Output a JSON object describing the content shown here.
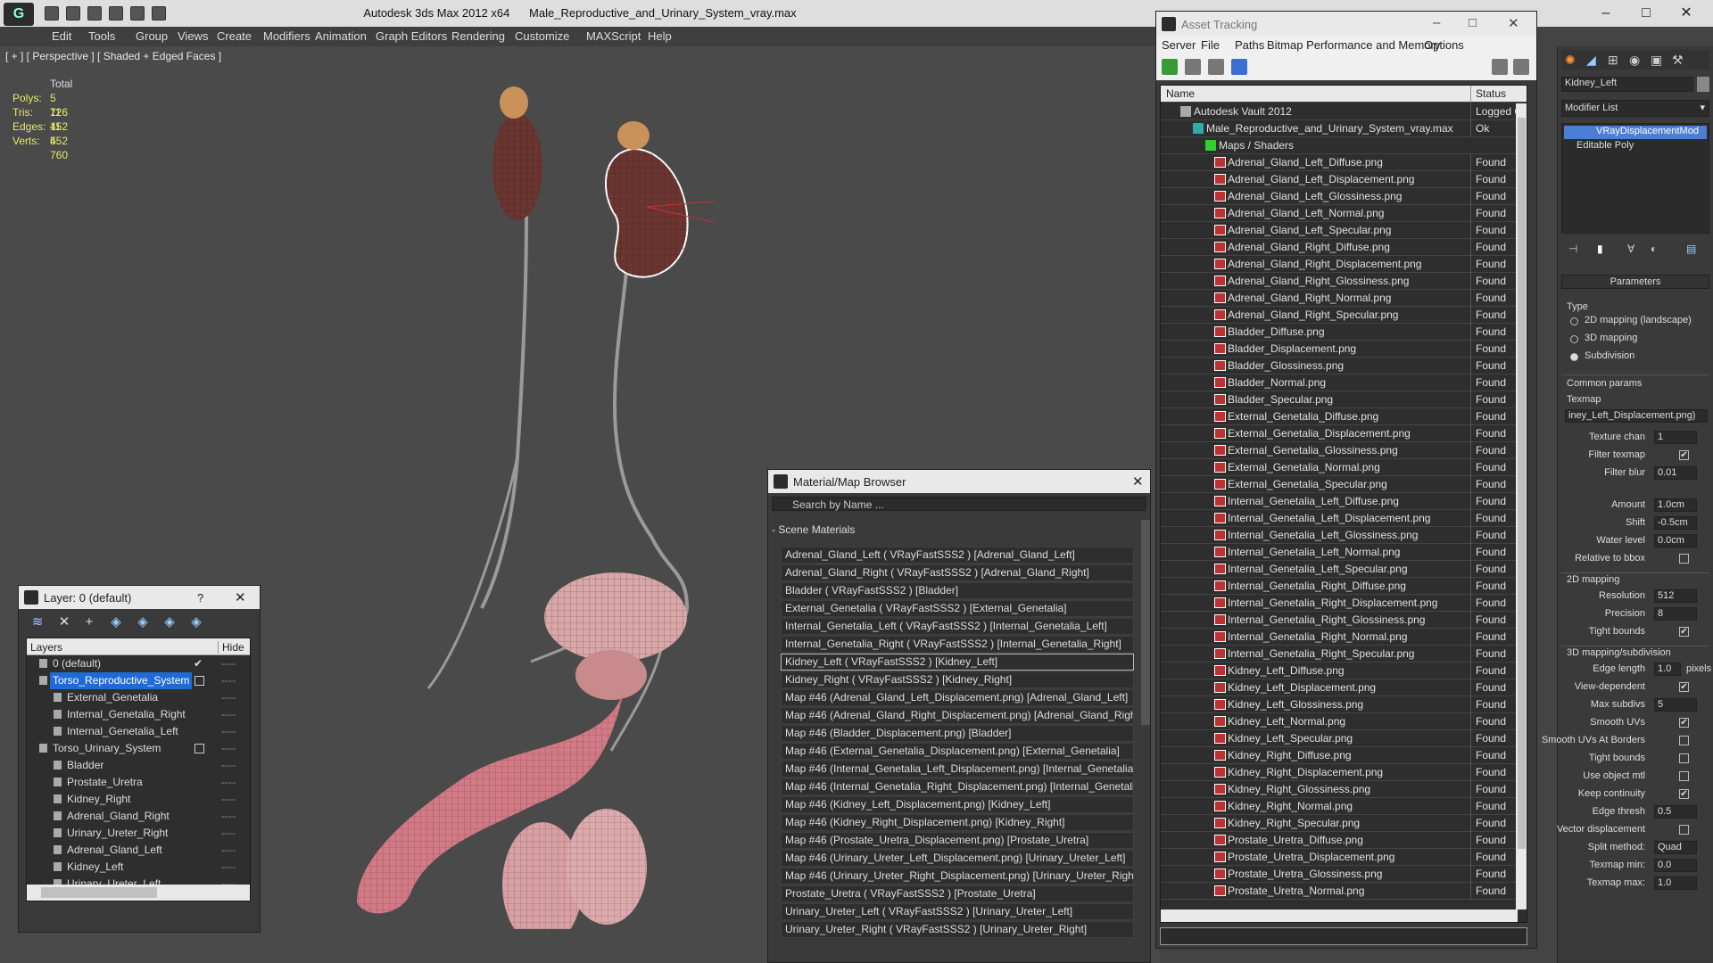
{
  "app": {
    "title": "Autodesk 3ds Max  2012 x64",
    "file": "Male_Reproductive_and_Urinary_System_vray.max"
  },
  "menu": [
    "Edit",
    "Tools",
    "Group",
    "Views",
    "Create",
    "Modifiers",
    "Animation",
    "Graph Editors",
    "Rendering",
    "Customize",
    "MAXScript",
    "Help"
  ],
  "viewport": {
    "label": "[ + ] [ Perspective ] [ Shaded + Edged Faces ]",
    "stats": {
      "header": "Total",
      "rows": [
        {
          "label": "Polys:",
          "value": "5 726"
        },
        {
          "label": "Tris:",
          "value": "11 452"
        },
        {
          "label": "Edges:",
          "value": "11 452"
        },
        {
          "label": "Verts:",
          "value": "5 760"
        }
      ]
    }
  },
  "layer_dialog": {
    "title": "Layer: 0 (default)",
    "help": "?",
    "col_layers": "Layers",
    "col_hide": "Hide",
    "rows": [
      {
        "name": "0 (default)",
        "level": 1
      },
      {
        "name": "Torso_Reproductive_System",
        "level": 1
      },
      {
        "name": "External_Genetalia",
        "level": 2
      },
      {
        "name": "Internal_Genetalia_Right",
        "level": 2
      },
      {
        "name": "Internal_Genetalia_Left",
        "level": 2
      },
      {
        "name": "Torso_Urinary_System",
        "level": 1
      },
      {
        "name": "Bladder",
        "level": 2
      },
      {
        "name": "Prostate_Uretra",
        "level": 2
      },
      {
        "name": "Kidney_Right",
        "level": 2
      },
      {
        "name": "Adrenal_Gland_Right",
        "level": 2
      },
      {
        "name": "Urinary_Ureter_Right",
        "level": 2
      },
      {
        "name": "Adrenal_Gland_Left",
        "level": 2
      },
      {
        "name": "Kidney_Left",
        "level": 2
      },
      {
        "name": "Urinary_Ureter_Left",
        "level": 2
      }
    ],
    "hide_mark": "----"
  },
  "material_browser": {
    "title": "Material/Map Browser",
    "search_placeholder": "Search by Name ...",
    "section": "- Scene Materials",
    "items": [
      "Adrenal_Gland_Left  ( VRayFastSSS2 )  [Adrenal_Gland_Left]",
      "Adrenal_Gland_Right  ( VRayFastSSS2 )  [Adrenal_Gland_Right]",
      "Bladder  ( VRayFastSSS2 )  [Bladder]",
      "External_Genetalia  ( VRayFastSSS2 )  [External_Genetalia]",
      "Internal_Genetalia_Left  ( VRayFastSSS2 )  [Internal_Genetalia_Left]",
      "Internal_Genetalia_Right  ( VRayFastSSS2 )  [Internal_Genetalia_Right]",
      "Kidney_Left  ( VRayFastSSS2 )  [Kidney_Left]",
      "Kidney_Right  ( VRayFastSSS2 )  [Kidney_Right]",
      "Map #46 (Adrenal_Gland_Left_Displacement.png) [Adrenal_Gland_Left]",
      "Map #46 (Adrenal_Gland_Right_Displacement.png) [Adrenal_Gland_Right]",
      "Map #46 (Bladder_Displacement.png) [Bladder]",
      "Map #46 (External_Genetalia_Displacement.png) [External_Genetalia]",
      "Map #46 (Internal_Genetalia_Left_Displacement.png) [Internal_Genetalia...",
      "Map #46 (Internal_Genetalia_Right_Displacement.png) [Internal_Genetali...",
      "Map #46 (Kidney_Left_Displacement.png) [Kidney_Left]",
      "Map #46 (Kidney_Right_Displacement.png) [Kidney_Right]",
      "Map #46 (Prostate_Uretra_Displacement.png) [Prostate_Uretra]",
      "Map #46 (Urinary_Ureter_Left_Displacement.png) [Urinary_Ureter_Left]",
      "Map #46 (Urinary_Ureter_Right_Displacement.png) [Urinary_Ureter_Right]",
      "Prostate_Uretra  ( VRayFastSSS2 )  [Prostate_Uretra]",
      "Urinary_Ureter_Left  ( VRayFastSSS2 )  [Urinary_Ureter_Left]",
      "Urinary_Ureter_Right  ( VRayFastSSS2 )  [Urinary_Ureter_Right]"
    ]
  },
  "asset_tracking": {
    "title": "Asset Tracking",
    "menu": [
      "Server",
      "File",
      "Paths",
      "Bitmap Performance and Memory",
      "Options"
    ],
    "col_name": "Name",
    "col_status": "Status",
    "vault": {
      "name": "Autodesk Vault 2012",
      "status": "Logged O"
    },
    "file": {
      "name": "Male_Reproductive_and_Urinary_System_vray.max",
      "status": "Ok"
    },
    "maps_folder": "Maps / Shaders",
    "maps": [
      "Adrenal_Gland_Left_Diffuse.png",
      "Adrenal_Gland_Left_Displacement.png",
      "Adrenal_Gland_Left_Glossiness.png",
      "Adrenal_Gland_Left_Normal.png",
      "Adrenal_Gland_Left_Specular.png",
      "Adrenal_Gland_Right_Diffuse.png",
      "Adrenal_Gland_Right_Displacement.png",
      "Adrenal_Gland_Right_Glossiness.png",
      "Adrenal_Gland_Right_Normal.png",
      "Adrenal_Gland_Right_Specular.png",
      "Bladder_Diffuse.png",
      "Bladder_Displacement.png",
      "Bladder_Glossiness.png",
      "Bladder_Normal.png",
      "Bladder_Specular.png",
      "External_Genetalia_Diffuse.png",
      "External_Genetalia_Displacement.png",
      "External_Genetalia_Glossiness.png",
      "External_Genetalia_Normal.png",
      "External_Genetalia_Specular.png",
      "Internal_Genetalia_Left_Diffuse.png",
      "Internal_Genetalia_Left_Displacement.png",
      "Internal_Genetalia_Left_Glossiness.png",
      "Internal_Genetalia_Left_Normal.png",
      "Internal_Genetalia_Left_Specular.png",
      "Internal_Genetalia_Right_Diffuse.png",
      "Internal_Genetalia_Right_Displacement.png",
      "Internal_Genetalia_Right_Glossiness.png",
      "Internal_Genetalia_Right_Normal.png",
      "Internal_Genetalia_Right_Specular.png",
      "Kidney_Left_Diffuse.png",
      "Kidney_Left_Displacement.png",
      "Kidney_Left_Glossiness.png",
      "Kidney_Left_Normal.png",
      "Kidney_Left_Specular.png",
      "Kidney_Right_Diffuse.png",
      "Kidney_Right_Displacement.png",
      "Kidney_Right_Glossiness.png",
      "Kidney_Right_Normal.png",
      "Kidney_Right_Specular.png",
      "Prostate_Uretra_Diffuse.png",
      "Prostate_Uretra_Displacement.png",
      "Prostate_Uretra_Glossiness.png",
      "Prostate_Uretra_Normal.png"
    ],
    "found": "Found"
  },
  "command_panel": {
    "object_name": "Kidney_Left",
    "modifier_list": "Modifier List",
    "stack": [
      "VRayDisplacementMod",
      "Editable Poly"
    ],
    "rollout": "Parameters",
    "type_label": "Type",
    "type_options": [
      "2D mapping (landscape)",
      "3D mapping",
      "Subdivision"
    ],
    "common_params": "Common params",
    "texmap_label": "Texmap",
    "texmap_value": "iney_Left_Displacement.png)",
    "fields": [
      {
        "label": "Texture chan",
        "value": "1"
      },
      {
        "label": "Filter texmap",
        "check": true
      },
      {
        "label": "Filter blur",
        "value": "0.01"
      },
      {
        "label": "Amount",
        "value": "1.0cm"
      },
      {
        "label": "Shift",
        "value": "-0.5cm"
      },
      {
        "label": "Water level",
        "value": "0.0cm"
      },
      {
        "label": "Relative to bbox",
        "check": false
      }
    ],
    "mapping2d": "2D mapping",
    "mapping2d_fields": [
      {
        "label": "Resolution",
        "value": "512"
      },
      {
        "label": "Precision",
        "value": "8"
      },
      {
        "label": "Tight bounds",
        "check": true
      }
    ],
    "mapping3d": "3D mapping/subdivision",
    "edge_length_label": "Edge length",
    "edge_length_value": "1.0",
    "pixels": "pixels",
    "mapping3d_fields": [
      {
        "label": "View-dependent",
        "check": true
      },
      {
        "label": "Max subdivs",
        "value": "5"
      },
      {
        "label": "Smooth UVs",
        "check": true
      },
      {
        "label": "Smooth UVs At Borders",
        "check": false
      },
      {
        "label": "Tight bounds",
        "check": false
      },
      {
        "label": "Use object mtl",
        "check": false
      },
      {
        "label": "Keep continuity",
        "check": true
      },
      {
        "label": "Edge thresh",
        "value": "0.5"
      },
      {
        "label": "Vector displacement",
        "check": false
      },
      {
        "label": "Split method:",
        "value": "Quad"
      },
      {
        "label": "Texmap min:",
        "value": "0.0"
      },
      {
        "label": "Texmap max:",
        "value": "1.0"
      }
    ]
  }
}
